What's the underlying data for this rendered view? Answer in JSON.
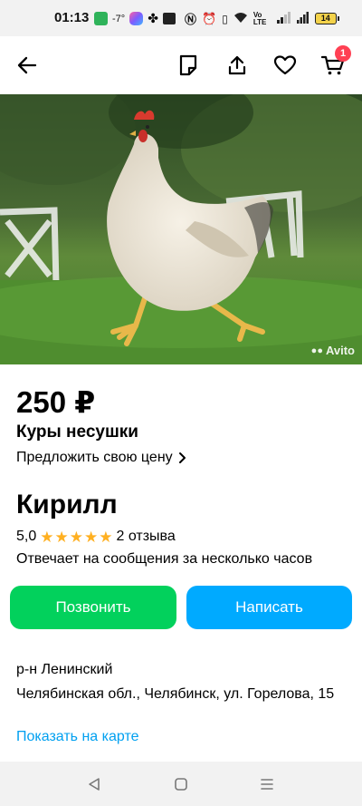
{
  "status_bar": {
    "time": "01:13",
    "temperature": "-7°",
    "network": "Vo LTE",
    "battery": "14"
  },
  "header": {
    "cart_count": "1",
    "icons": [
      "back-arrow-icon",
      "note-icon",
      "share-icon",
      "heart-icon",
      "cart-icon"
    ]
  },
  "photo": {
    "watermark": "Avito"
  },
  "listing": {
    "price": "250 ₽",
    "title": "Куры несушки",
    "offer_price_link": "Предложить свою цену"
  },
  "seller": {
    "name": "Кирилл",
    "rating": "5,0",
    "stars": 5,
    "reviews": "2 отзыва",
    "response_time": "Отвечает на сообщения за несколько часов"
  },
  "actions": {
    "call": "Позвонить",
    "write": "Написать"
  },
  "location": {
    "district": "р-н Ленинский",
    "address": "Челябинская обл., Челябинск, ул. Горелова, 15",
    "map_link": "Показать на карте"
  },
  "colors": {
    "call_button": "#02d15c",
    "write_button": "#00aaff",
    "link": "#00a0f0",
    "star": "#ffb021",
    "badge": "#ff4053"
  }
}
